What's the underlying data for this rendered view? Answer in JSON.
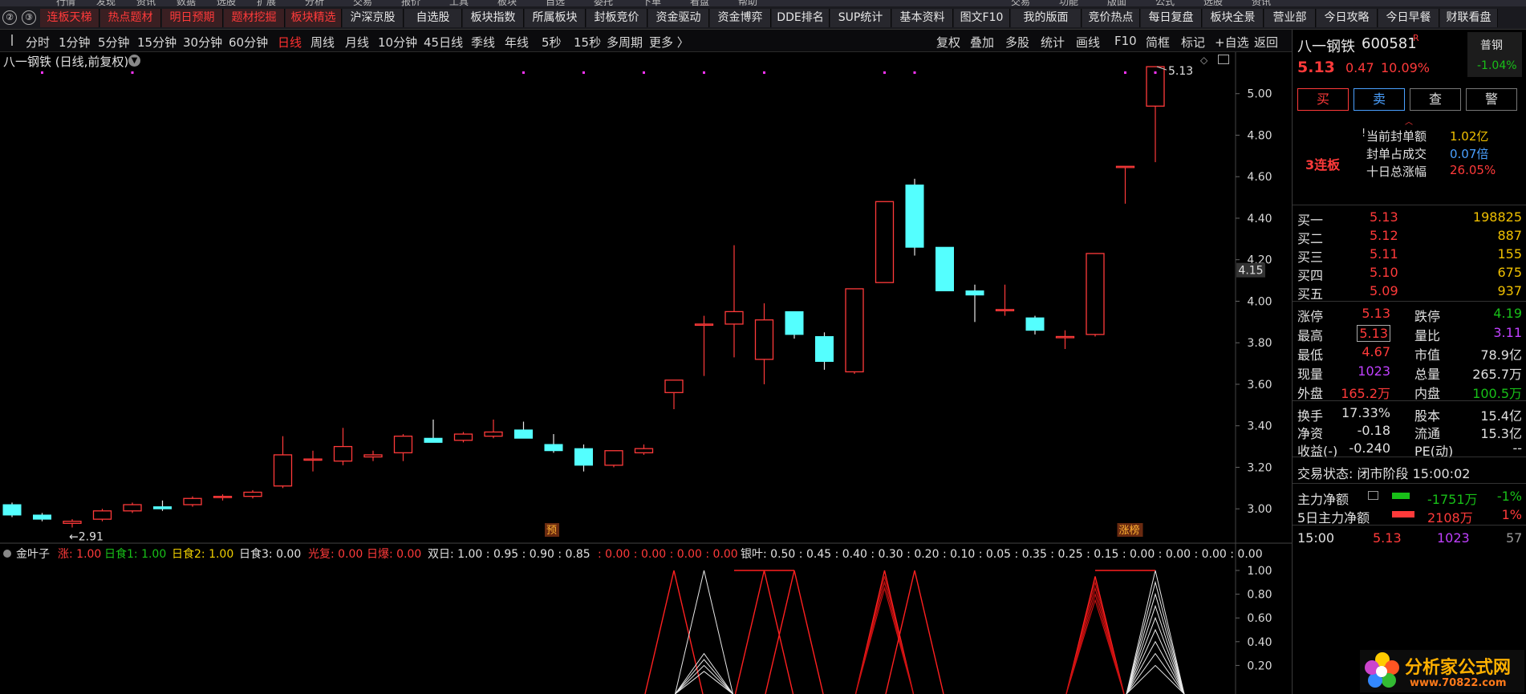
{
  "menu_top": [
    "行情",
    "发现",
    "资讯",
    "数据",
    "选股",
    "扩展",
    "分析",
    "交易",
    "报价",
    "工具",
    "板块",
    "自选",
    "委托",
    "下单",
    "看盘",
    "帮助",
    "交易",
    "功能",
    "版面",
    "公式",
    "选股",
    "资讯"
  ],
  "tabbar": {
    "icons": [
      "②",
      "③"
    ],
    "tabs": [
      {
        "label": "连板天梯",
        "red": true
      },
      {
        "label": "热点题材",
        "red": true
      },
      {
        "label": "明日预期",
        "red": true
      },
      {
        "label": "题材挖掘",
        "red": true
      },
      {
        "label": "板块精选",
        "red": true
      },
      {
        "label": "沪深京股",
        "red": false
      },
      {
        "label": "自选股",
        "red": false
      },
      {
        "label": "板块指数",
        "red": false
      },
      {
        "label": "所属板块",
        "red": false
      },
      {
        "label": "封板竞价",
        "red": false
      },
      {
        "label": "资金驱动",
        "red": false
      },
      {
        "label": "资金博弈",
        "red": false
      },
      {
        "label": "DDE排名",
        "red": false
      },
      {
        "label": "SUP统计",
        "red": false
      },
      {
        "label": "基本资料",
        "red": false
      },
      {
        "label": "图文F10",
        "red": false
      },
      {
        "label": "我的版面",
        "red": false
      },
      {
        "label": "竞价热点",
        "red": false
      },
      {
        "label": "每日复盘",
        "red": false
      },
      {
        "label": "板块全景",
        "red": false
      },
      {
        "label": "营业部",
        "red": false
      },
      {
        "label": "今日攻略",
        "red": false
      },
      {
        "label": "今日早餐",
        "red": false
      },
      {
        "label": "财联看盘",
        "red": false
      }
    ]
  },
  "periodbar": {
    "items": [
      "分时",
      "1分钟",
      "5分钟",
      "15分钟",
      "30分钟",
      "60分钟",
      "日线",
      "周线",
      "月线",
      "10分钟",
      "45日线",
      "季线",
      "年线",
      "5秒",
      "15秒",
      "多周期",
      "更多 〉"
    ],
    "active": "日线",
    "right_items": [
      "复权",
      "叠加",
      "多股",
      "统计",
      "画线",
      "F10",
      "简框",
      "标记",
      "+自选",
      "返回"
    ]
  },
  "chart_header": "八一钢铁 (日线,前复权)",
  "colors": {
    "up": "#ff3a3a",
    "down": "#54ffff",
    "magenta": "#ff33ff",
    "yellow": "#f0d000",
    "green": "#18c018"
  },
  "chart_data": {
    "type": "candlestick",
    "ylim": [
      2.85,
      5.2
    ],
    "yticks": [
      "5.00",
      "4.80",
      "4.60",
      "4.40",
      "4.20",
      "4.00",
      "3.80",
      "3.60",
      "3.40",
      "3.20",
      "3.00"
    ],
    "last_price_tag": "4.15",
    "high_label": "5.13",
    "low_label": "←2.91",
    "candles": [
      {
        "o": 3.02,
        "h": 3.03,
        "l": 2.96,
        "c": 2.97
      },
      {
        "o": 2.97,
        "h": 2.98,
        "l": 2.94,
        "c": 2.95
      },
      {
        "o": 2.93,
        "h": 2.95,
        "l": 2.91,
        "c": 2.94
      },
      {
        "o": 2.95,
        "h": 3.0,
        "l": 2.94,
        "c": 2.99
      },
      {
        "o": 2.99,
        "h": 3.03,
        "l": 2.98,
        "c": 3.02
      },
      {
        "o": 3.01,
        "h": 3.04,
        "l": 2.99,
        "c": 3.0
      },
      {
        "o": 3.02,
        "h": 3.06,
        "l": 3.01,
        "c": 3.05
      },
      {
        "o": 3.06,
        "h": 3.07,
        "l": 3.04,
        "c": 3.06
      },
      {
        "o": 3.06,
        "h": 3.09,
        "l": 3.05,
        "c": 3.08
      },
      {
        "o": 3.11,
        "h": 3.35,
        "l": 3.1,
        "c": 3.26
      },
      {
        "o": 3.24,
        "h": 3.28,
        "l": 3.18,
        "c": 3.24
      },
      {
        "o": 3.23,
        "h": 3.39,
        "l": 3.21,
        "c": 3.3
      },
      {
        "o": 3.25,
        "h": 3.28,
        "l": 3.23,
        "c": 3.26
      },
      {
        "o": 3.27,
        "h": 3.36,
        "l": 3.23,
        "c": 3.35
      },
      {
        "o": 3.34,
        "h": 3.43,
        "l": 3.32,
        "c": 3.32
      },
      {
        "o": 3.33,
        "h": 3.37,
        "l": 3.32,
        "c": 3.36
      },
      {
        "o": 3.35,
        "h": 3.43,
        "l": 3.34,
        "c": 3.37
      },
      {
        "o": 3.38,
        "h": 3.42,
        "l": 3.34,
        "c": 3.34
      },
      {
        "o": 3.31,
        "h": 3.36,
        "l": 3.27,
        "c": 3.28
      },
      {
        "o": 3.29,
        "h": 3.31,
        "l": 3.18,
        "c": 3.21
      },
      {
        "o": 3.21,
        "h": 3.28,
        "l": 3.2,
        "c": 3.28
      },
      {
        "o": 3.27,
        "h": 3.31,
        "l": 3.26,
        "c": 3.29
      },
      {
        "o": 3.56,
        "h": 3.62,
        "l": 3.48,
        "c": 3.62
      },
      {
        "o": 3.89,
        "h": 3.93,
        "l": 3.64,
        "c": 3.89
      },
      {
        "o": 3.89,
        "h": 4.27,
        "l": 3.73,
        "c": 3.95
      },
      {
        "o": 3.72,
        "h": 3.99,
        "l": 3.6,
        "c": 3.91
      },
      {
        "o": 3.95,
        "h": 3.95,
        "l": 3.82,
        "c": 3.84
      },
      {
        "o": 3.83,
        "h": 3.85,
        "l": 3.67,
        "c": 3.71
      },
      {
        "o": 3.66,
        "h": 4.06,
        "l": 3.65,
        "c": 4.06
      },
      {
        "o": 4.09,
        "h": 4.48,
        "l": 4.09,
        "c": 4.48
      },
      {
        "o": 4.56,
        "h": 4.59,
        "l": 4.22,
        "c": 4.26
      },
      {
        "o": 4.26,
        "h": 4.26,
        "l": 4.05,
        "c": 4.05
      },
      {
        "o": 4.05,
        "h": 4.08,
        "l": 3.9,
        "c": 4.03
      },
      {
        "o": 3.96,
        "h": 4.08,
        "l": 3.93,
        "c": 3.96
      },
      {
        "o": 3.92,
        "h": 3.93,
        "l": 3.84,
        "c": 3.86
      },
      {
        "o": 3.83,
        "h": 3.86,
        "l": 3.77,
        "c": 3.83
      },
      {
        "o": 3.84,
        "h": 4.23,
        "l": 3.83,
        "c": 4.23
      },
      {
        "o": 4.65,
        "h": 4.65,
        "l": 4.47,
        "c": 4.65
      },
      {
        "o": 4.94,
        "h": 5.13,
        "l": 4.67,
        "c": 5.13
      }
    ],
    "markers": [
      {
        "i": 1,
        "text": "",
        "color": "magenta"
      },
      {
        "i": 4,
        "text": "",
        "color": "magenta"
      },
      {
        "i": 17,
        "text": "",
        "color": "magenta"
      },
      {
        "i": 19,
        "text": "",
        "color": "magenta"
      },
      {
        "i": 21,
        "text": "",
        "color": "magenta"
      },
      {
        "i": 23,
        "text": "",
        "color": "magenta"
      },
      {
        "i": 25,
        "text": "",
        "color": "magenta"
      },
      {
        "i": 29,
        "text": "",
        "color": "magenta"
      },
      {
        "i": 30,
        "text": "",
        "color": "magenta"
      },
      {
        "i": 37,
        "text": "",
        "color": "magenta"
      },
      {
        "i": 38,
        "text": "",
        "color": "magenta"
      }
    ],
    "event_labels": [
      {
        "i": 18,
        "text": "预"
      },
      {
        "i": 37,
        "text": "涨榜"
      }
    ],
    "indicator": {
      "name": "金叶子",
      "legend": [
        {
          "label": "涨: 1.00",
          "color": "#ff3a3a"
        },
        {
          "label": "日食1: 1.00",
          "color": "#18c018"
        },
        {
          "label": "日食2: 1.00",
          "color": "#f0d000"
        },
        {
          "label": "日食3: 0.00",
          "color": "#e0e0e0"
        },
        {
          "label": "光复: 0.00",
          "color": "#ff3a3a"
        },
        {
          "label": "日爆: 0.00",
          "color": "#ff3a3a"
        },
        {
          "label": "双日: 1.00 : 0.95 : 0.90 : 0.85",
          "color": "#e0e0e0"
        },
        {
          "label": ": 0.00 : 0.00 : 0.00 : 0.00",
          "color": "#ff3a3a"
        },
        {
          "label": "银叶: 0.50 : 0.45 : 0.40 : 0.30 : 0.20 : 0.10 : 0.05 : 0.35 : 0.25 : 0.15 : 0.00 : 0.00 : 0.00 : 0.00",
          "color": "#e0e0e0"
        }
      ],
      "ylim": [
        0.0,
        1.0
      ],
      "yticks": [
        "1.00",
        "0.80",
        "0.60",
        "0.40",
        "0.20"
      ],
      "spikes_red": [
        {
          "i": 22,
          "values": [
            1.0
          ]
        },
        {
          "i": 25,
          "values": [
            1.0
          ]
        },
        {
          "i": 26,
          "values": [
            1.0
          ]
        },
        {
          "i": 29,
          "values": [
            1.0,
            0.9,
            0.85,
            0.95
          ]
        },
        {
          "i": 30,
          "values": [
            1.0
          ]
        },
        {
          "i": 36,
          "values": [
            0.95,
            0.9,
            0.85,
            0.8,
            0.75
          ]
        }
      ],
      "spikes_white": [
        {
          "i": 23,
          "values": [
            1.0,
            0.3,
            0.25,
            0.2,
            0.15
          ]
        },
        {
          "i": 38,
          "values": [
            1.0,
            0.9,
            0.8,
            0.7,
            0.6,
            0.5,
            0.4,
            0.3,
            0.2
          ]
        }
      ],
      "flat_segments": [
        {
          "from": 24,
          "to": 26
        },
        {
          "from": 36,
          "to": 38
        }
      ]
    }
  },
  "panel": {
    "name": "八一钢铁",
    "code": "600581",
    "badge": "R",
    "tag": "普钢",
    "tag_change": "-1.04%",
    "price": "5.13",
    "change": "0.47",
    "change_pct": "10.09%",
    "buttons": [
      "买",
      "卖",
      "查",
      "警"
    ],
    "streak": "3连板",
    "seal_rows": [
      {
        "label": "当前封单额",
        "value": "1.02亿",
        "color": "#f0c000"
      },
      {
        "label": "封单占成交",
        "value": "0.07倍",
        "color": "#4aa0ff"
      },
      {
        "label": "十日总涨幅",
        "value": "26.05%",
        "color": "#ff3a3a"
      }
    ],
    "bids": [
      {
        "label": "买一",
        "price": "5.13",
        "vol": "198825"
      },
      {
        "label": "买二",
        "price": "5.12",
        "vol": "887"
      },
      {
        "label": "买三",
        "price": "5.11",
        "vol": "155"
      },
      {
        "label": "买四",
        "price": "5.10",
        "vol": "675"
      },
      {
        "label": "买五",
        "price": "5.09",
        "vol": "937"
      }
    ],
    "stats": [
      {
        "l1": "涨停",
        "v1": "5.13",
        "c1": "#ff3a3a",
        "l2": "跌停",
        "v2": "4.19",
        "c2": "#18c018"
      },
      {
        "l1": "最高",
        "v1": "5.13",
        "c1": "#ff3a3a",
        "l2": "量比",
        "v2": "3.11",
        "c2": "#c040ff"
      },
      {
        "l1": "最低",
        "v1": "4.67",
        "c1": "#ff3a3a",
        "l2": "市值",
        "v2": "78.9亿",
        "c2": "#e0e0e0"
      },
      {
        "l1": "现量",
        "v1": "1023",
        "c1": "#c040ff",
        "l2": "总量",
        "v2": "265.7万",
        "c2": "#e0e0e0"
      },
      {
        "l1": "外盘",
        "v1": "165.2万",
        "c1": "#ff3a3a",
        "l2": "内盘",
        "v2": "100.5万",
        "c2": "#18c018"
      }
    ],
    "stats2": [
      {
        "l1": "换手",
        "v1": "17.33%",
        "l2": "股本",
        "v2": "15.4亿"
      },
      {
        "l1": "净资",
        "v1": "-0.18",
        "l2": "流通",
        "v2": "15.3亿"
      },
      {
        "l1": "收益(-)",
        "v1": "-0.240",
        "l2": "PE(动)",
        "v2": "--"
      }
    ],
    "trade_status": "交易状态: 闭市阶段 15:00:02",
    "flows": [
      {
        "label": "主力净额",
        "value": "-1751万",
        "pct": "-1%",
        "color": "#18c018"
      },
      {
        "label": "5日主力净额",
        "value": "2108万",
        "pct": "1%",
        "color": "#ff3a3a"
      }
    ],
    "tick": {
      "time": "15:00",
      "price": "5.13",
      "vol": "1023",
      "n": "57"
    }
  },
  "watermark": {
    "title": "分析家公式网",
    "url": "www.70822.com"
  }
}
